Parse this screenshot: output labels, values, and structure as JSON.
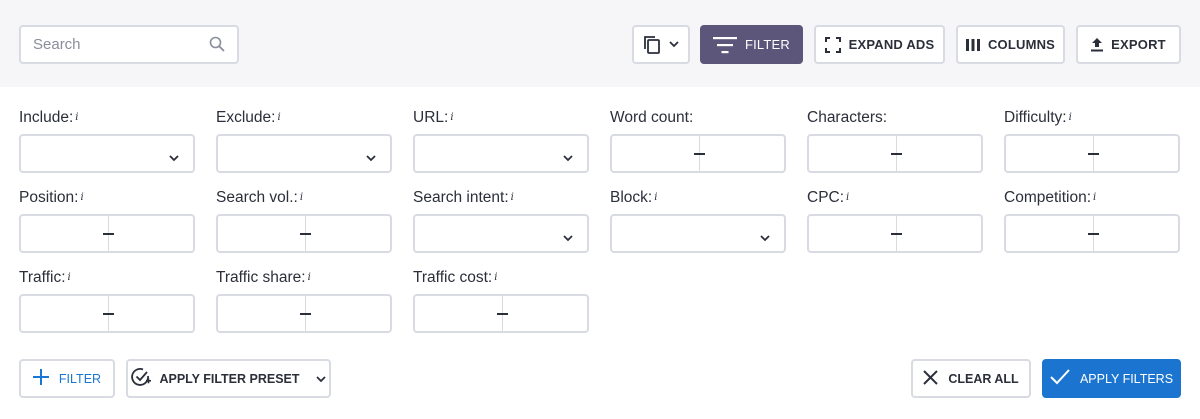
{
  "search": {
    "placeholder": "Search",
    "icon": "search-icon"
  },
  "toolbar": {
    "copy_icon": "copy-icon",
    "filter_label": "FILTER",
    "expand_ads_label": "EXPAND ADS",
    "columns_label": "COLUMNS",
    "export_label": "EXPORT",
    "filter_bg": "#5b567a"
  },
  "filters": {
    "include": {
      "label": "Include:",
      "info": "i"
    },
    "exclude": {
      "label": "Exclude:",
      "info": "i"
    },
    "url": {
      "label": "URL:",
      "info": "i"
    },
    "word_count": {
      "label": "Word count:"
    },
    "characters": {
      "label": "Characters:"
    },
    "difficulty": {
      "label": "Difficulty:",
      "info": "i"
    },
    "position": {
      "label": "Position:",
      "info": "i"
    },
    "search_vol": {
      "label": "Search vol.:",
      "info": "i"
    },
    "search_intent": {
      "label": "Search intent:",
      "info": "i"
    },
    "block": {
      "label": "Block:",
      "info": "i"
    },
    "cpc": {
      "label": "CPC:",
      "info": "i"
    },
    "competition": {
      "label": "Competition:",
      "info": "i"
    },
    "traffic": {
      "label": "Traffic:",
      "info": "i"
    },
    "traffic_share": {
      "label": "Traffic share:",
      "info": "i"
    },
    "traffic_cost": {
      "label": "Traffic cost:",
      "info": "i"
    }
  },
  "actions": {
    "add_filter_label": "FILTER",
    "preset_label": "APPLY FILTER PRESET",
    "clear_all_label": "CLEAR ALL",
    "apply_label": "APPLY FILTERS",
    "accent": "#1b75d0"
  }
}
